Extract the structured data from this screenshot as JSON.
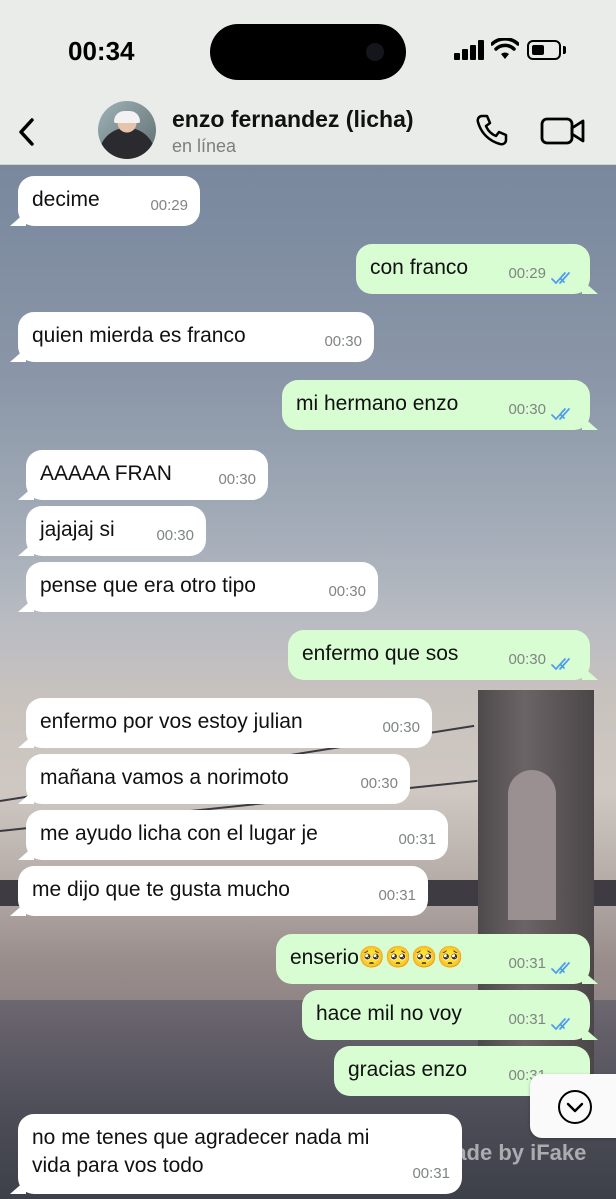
{
  "status_bar": {
    "time": "00:34"
  },
  "contact": {
    "name": "enzo fernandez (licha)",
    "presence": "en línea"
  },
  "messages": [
    {
      "dir": "in",
      "text": "decime",
      "time": "00:29"
    },
    {
      "dir": "out",
      "text": "con franco",
      "time": "00:29"
    },
    {
      "dir": "in",
      "text": "quien mierda es franco",
      "time": "00:30"
    },
    {
      "dir": "out",
      "text": "mi hermano enzo",
      "time": "00:30"
    },
    {
      "dir": "in",
      "text": "AAAAA FRAN",
      "time": "00:30"
    },
    {
      "dir": "in",
      "text": "jajajaj si",
      "time": "00:30"
    },
    {
      "dir": "in",
      "text": "pense que era otro tipo",
      "time": "00:30"
    },
    {
      "dir": "out",
      "text": "enfermo que sos",
      "time": "00:30"
    },
    {
      "dir": "in",
      "text": "enfermo por vos estoy julian",
      "time": "00:30"
    },
    {
      "dir": "in",
      "text": "mañana vamos a norimoto",
      "time": "00:30"
    },
    {
      "dir": "in",
      "text": "me ayudo licha con el lugar je",
      "time": "00:31"
    },
    {
      "dir": "in",
      "text": "me dijo que te gusta mucho",
      "time": "00:31"
    },
    {
      "dir": "out",
      "text": "enserio🥺🥺🥺🥺",
      "time": "00:31"
    },
    {
      "dir": "out",
      "text": "hace mil no voy",
      "time": "00:31"
    },
    {
      "dir": "out",
      "text": "gracias enzo",
      "time": "00:31"
    },
    {
      "dir": "in",
      "text": "no me tenes que agradecer nada mi\nvida para vos todo",
      "time": "00:31"
    }
  ],
  "watermark": "Made by iFake",
  "colors": {
    "incoming": "#ffffff",
    "outgoing": "#d9fdd3",
    "read_ticks": "#4f9cf0"
  },
  "icons": {
    "back": "chevron-left-icon",
    "call": "phone-icon",
    "video": "video-camera-icon",
    "scroll": "chevron-down-circle-icon"
  }
}
